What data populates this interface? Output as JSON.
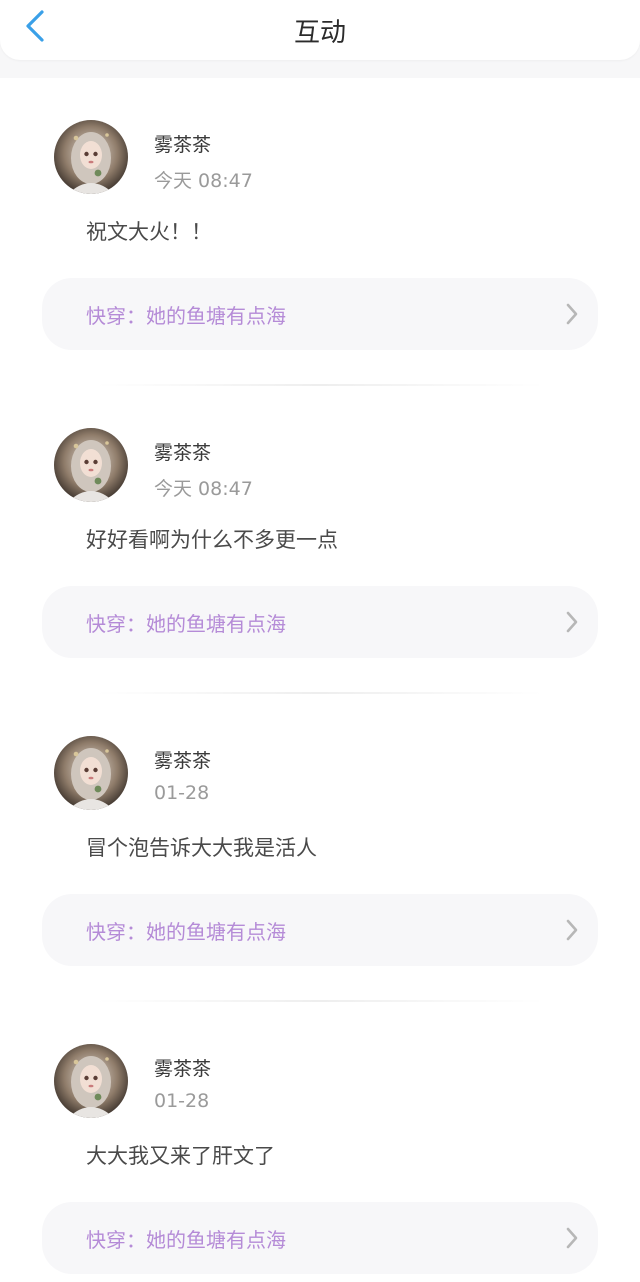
{
  "header": {
    "title": "互动",
    "back_icon": "chevron-left-icon",
    "accent_color": "#3aa0e8"
  },
  "items": [
    {
      "username": "雾茶茶",
      "time": "今天  08:47",
      "comment": "祝文大火！！",
      "book_title": "快穿：她的鱼塘有点海"
    },
    {
      "username": "雾茶茶",
      "time": "今天  08:47",
      "comment": "好好看啊为什么不多更一点",
      "book_title": "快穿：她的鱼塘有点海"
    },
    {
      "username": "雾茶茶",
      "time": "01-28",
      "comment": "冒个泡告诉大大我是活人",
      "book_title": "快穿：她的鱼塘有点海"
    },
    {
      "username": "雾茶茶",
      "time": "01-28",
      "comment": "大大我又来了肝文了",
      "book_title": "快穿：她的鱼塘有点海"
    }
  ],
  "colors": {
    "book_link_text": "#b58bd7",
    "username_text": "#3a3a3a",
    "time_text": "#9a9a9a",
    "comment_text": "#4a4a4a"
  }
}
